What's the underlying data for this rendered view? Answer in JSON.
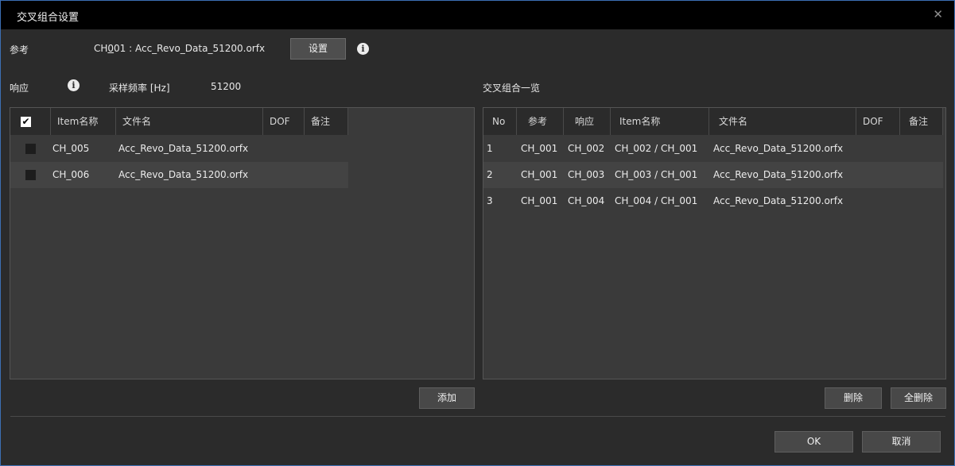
{
  "window": {
    "title": "交叉组合设置",
    "close": "✕"
  },
  "reference": {
    "label": "参考",
    "pre": "CH",
    "underline": "0",
    "post": "01 : Acc_Revo_Data_51200.orfx",
    "set_button": "设置",
    "info": "i"
  },
  "response": {
    "label": "响应",
    "info": "i",
    "sampling_label": "采样频率 [Hz]",
    "sampling_value": "51200"
  },
  "left_table": {
    "headers": [
      "Item名称",
      "文件名",
      "DOF",
      "备注"
    ],
    "header_check": "✔",
    "rows": [
      {
        "item": "CH_005",
        "file": "Acc_Revo_Data_51200.orfx"
      },
      {
        "item": "CH_006",
        "file": "Acc_Revo_Data_51200.orfx"
      }
    ]
  },
  "right_title": "交叉组合一览",
  "right_table": {
    "headers": [
      "No",
      "参考",
      "响应",
      "Item名称",
      "文件名",
      "DOF",
      "备注"
    ],
    "rows": [
      {
        "no": "1",
        "ref": "CH_001",
        "resp": "CH_002",
        "item": "CH_002 / CH_001",
        "file": "Acc_Revo_Data_51200.orfx"
      },
      {
        "no": "2",
        "ref": "CH_001",
        "resp": "CH_003",
        "item": "CH_003 / CH_001",
        "file": "Acc_Revo_Data_51200.orfx"
      },
      {
        "no": "3",
        "ref": "CH_001",
        "resp": "CH_004",
        "item": "CH_004 / CH_001",
        "file": "Acc_Revo_Data_51200.orfx"
      }
    ]
  },
  "buttons": {
    "add": "添加",
    "delete": "删除",
    "delete_all": "全删除",
    "ok": "OK",
    "cancel": "取消"
  }
}
